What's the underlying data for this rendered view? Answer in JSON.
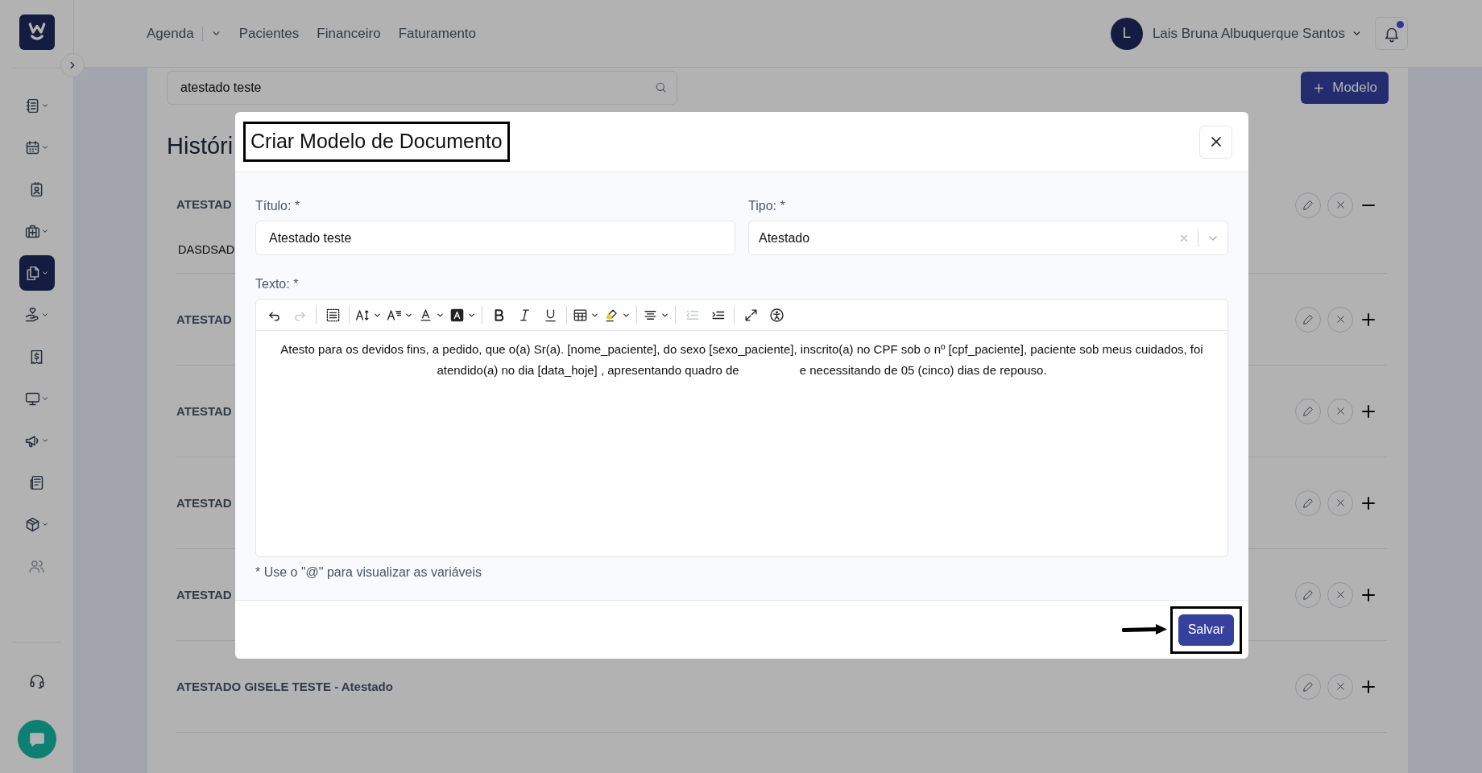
{
  "sidebar": {
    "items": [
      {
        "selected": false,
        "dropdown": true,
        "disabled": false
      },
      {
        "selected": false,
        "dropdown": true,
        "disabled": false
      },
      {
        "selected": false,
        "dropdown": false,
        "disabled": false
      },
      {
        "selected": false,
        "dropdown": true,
        "disabled": false
      },
      {
        "selected": true,
        "dropdown": true,
        "disabled": false
      },
      {
        "selected": false,
        "dropdown": true,
        "disabled": false
      },
      {
        "selected": false,
        "dropdown": false,
        "disabled": false
      },
      {
        "selected": false,
        "dropdown": true,
        "disabled": false
      },
      {
        "selected": false,
        "dropdown": true,
        "disabled": false
      },
      {
        "selected": false,
        "dropdown": false,
        "disabled": false
      },
      {
        "selected": false,
        "dropdown": true,
        "disabled": false
      },
      {
        "selected": false,
        "dropdown": false,
        "disabled": true
      }
    ]
  },
  "topbar": {
    "nav": [
      {
        "label": "Agenda",
        "dropdown": true
      },
      {
        "label": "Pacientes",
        "dropdown": false
      },
      {
        "label": "Financeiro",
        "dropdown": false
      },
      {
        "label": "Faturamento",
        "dropdown": false
      }
    ],
    "user": {
      "initial": "L",
      "name": "Lais Bruna Albuquerque Santos"
    },
    "notifications": {
      "unread": true
    }
  },
  "page": {
    "search": {
      "value": "atestado teste"
    },
    "add_button": "Modelo",
    "heading": "Históri",
    "rows": [
      {
        "title": "ATESTAD",
        "expanded": true,
        "body": "DASDSAD"
      },
      {
        "title": "ATESTAD",
        "expanded": false
      },
      {
        "title": "ATESTAD",
        "expanded": false
      },
      {
        "title": "ATESTAD",
        "expanded": false
      },
      {
        "title": "ATESTAD",
        "expanded": false
      },
      {
        "title": "ATESTADO GISELE TESTE - Atestado",
        "expanded": false
      }
    ]
  },
  "modal": {
    "title": "Criar Modelo de Documento",
    "title_highlighted": true,
    "titulo": {
      "label": "Título: *",
      "value": "Atestado teste"
    },
    "tipo": {
      "label": "Tipo: *",
      "value": "Atestado"
    },
    "texto": {
      "label": "Texto: *",
      "toolbar": [
        [
          {
            "dropdown": false,
            "disabled": false
          },
          {
            "dropdown": false,
            "disabled": true
          }
        ],
        [
          {
            "dropdown": false,
            "disabled": false
          }
        ],
        [
          {
            "dropdown": true,
            "disabled": false
          },
          {
            "dropdown": true,
            "disabled": false
          },
          {
            "dropdown": true,
            "disabled": false
          },
          {
            "dropdown": true,
            "disabled": false
          }
        ],
        [
          {
            "dropdown": false,
            "disabled": false
          },
          {
            "dropdown": false,
            "disabled": false
          },
          {
            "dropdown": false,
            "disabled": false
          }
        ],
        [
          {
            "dropdown": true,
            "disabled": false
          },
          {
            "dropdown": true,
            "disabled": false
          }
        ],
        [
          {
            "dropdown": true,
            "disabled": false
          }
        ],
        [
          {
            "dropdown": false,
            "disabled": true
          },
          {
            "dropdown": false,
            "disabled": false
          }
        ],
        [
          {
            "dropdown": false,
            "disabled": false
          },
          {
            "dropdown": false,
            "disabled": false
          }
        ]
      ],
      "content": "Atesto para os devidos fins, a pedido, que o(a) Sr(a). [nome_paciente], do sexo [sexo_paciente], inscrito(a) no CPF sob o nº [cpf_paciente], paciente sob meus cuidados, foi\natendido(a) no dia [data_hoje] , apresentando quadro de                  e necessitando de 05 (cinco) dias de repouso.",
      "hint": "* Use o \"@\" para visualizar as variáveis"
    },
    "save": {
      "label": "Salvar",
      "highlighted": true,
      "pointer_arrow": true
    }
  }
}
